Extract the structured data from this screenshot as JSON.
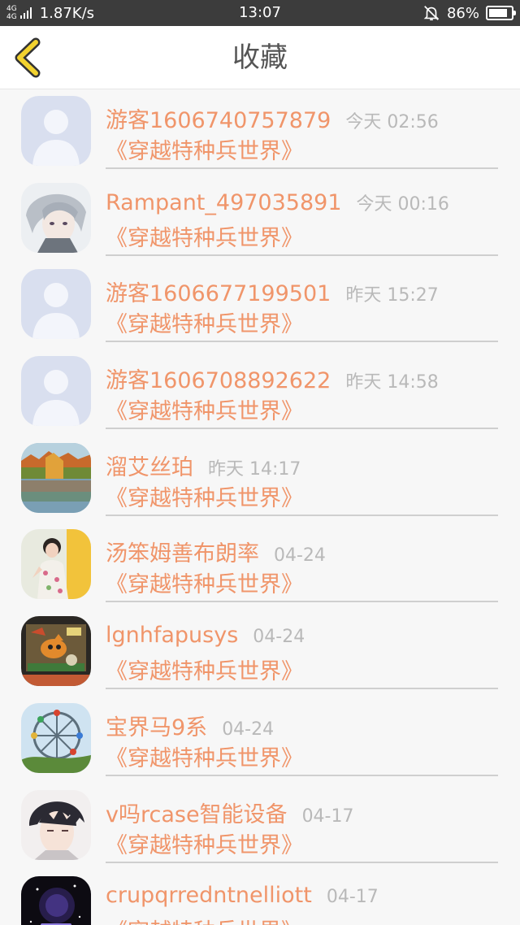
{
  "status_bar": {
    "network": "4G",
    "network2": "4G",
    "speed": "1.87K/s",
    "time": "13:07",
    "battery": "86%",
    "battery_level": 0.86,
    "icons": [
      "signal-icon",
      "bell-muted-icon",
      "battery-icon"
    ]
  },
  "header": {
    "title": "收藏",
    "back_icon": "chevron-left-icon",
    "accent": "#f2d22e"
  },
  "colors": {
    "name": "#f0956a",
    "book": "#f0956a",
    "time": "#b9b9b9"
  },
  "favorites": [
    {
      "name": "游客1606740757879",
      "time": "今天 02:56",
      "book": "《穿越特种兵世界》",
      "avatar": "default-avatar-icon"
    },
    {
      "name": "Rampant_497035891",
      "time": "今天 00:16",
      "book": "《穿越特种兵世界》",
      "avatar": "anime-boy-avatar"
    },
    {
      "name": "游客1606677199501",
      "time": "昨天 15:27",
      "book": "《穿越特种兵世界》",
      "avatar": "default-avatar-icon"
    },
    {
      "name": "游客1606708892622",
      "time": "昨天 14:58",
      "book": "《穿越特种兵世界》",
      "avatar": "default-avatar-icon"
    },
    {
      "name": "溜艾丝珀",
      "time": "昨天 14:17",
      "book": "《穿越特种兵世界》",
      "avatar": "lake-avatar"
    },
    {
      "name": "汤笨姆善布朗率",
      "time": "04-24",
      "book": "《穿越特种兵世界》",
      "avatar": "girl-photo-avatar"
    },
    {
      "name": "lgnhfapusys",
      "time": "04-24",
      "book": "《穿越特种兵世界》",
      "avatar": "cartoon-avatar"
    },
    {
      "name": "宝界马9系",
      "time": "04-24",
      "book": "《穿越特种兵世界》",
      "avatar": "ferris-wheel-avatar"
    },
    {
      "name": "v吗rcase智能设备",
      "time": "04-17",
      "book": "《穿越特种兵世界》",
      "avatar": "anime-man-avatar"
    },
    {
      "name": "crupqrredntnelliott",
      "time": "04-17",
      "book": "《穿越特种兵世界》",
      "avatar": "constellation-avatar"
    }
  ]
}
